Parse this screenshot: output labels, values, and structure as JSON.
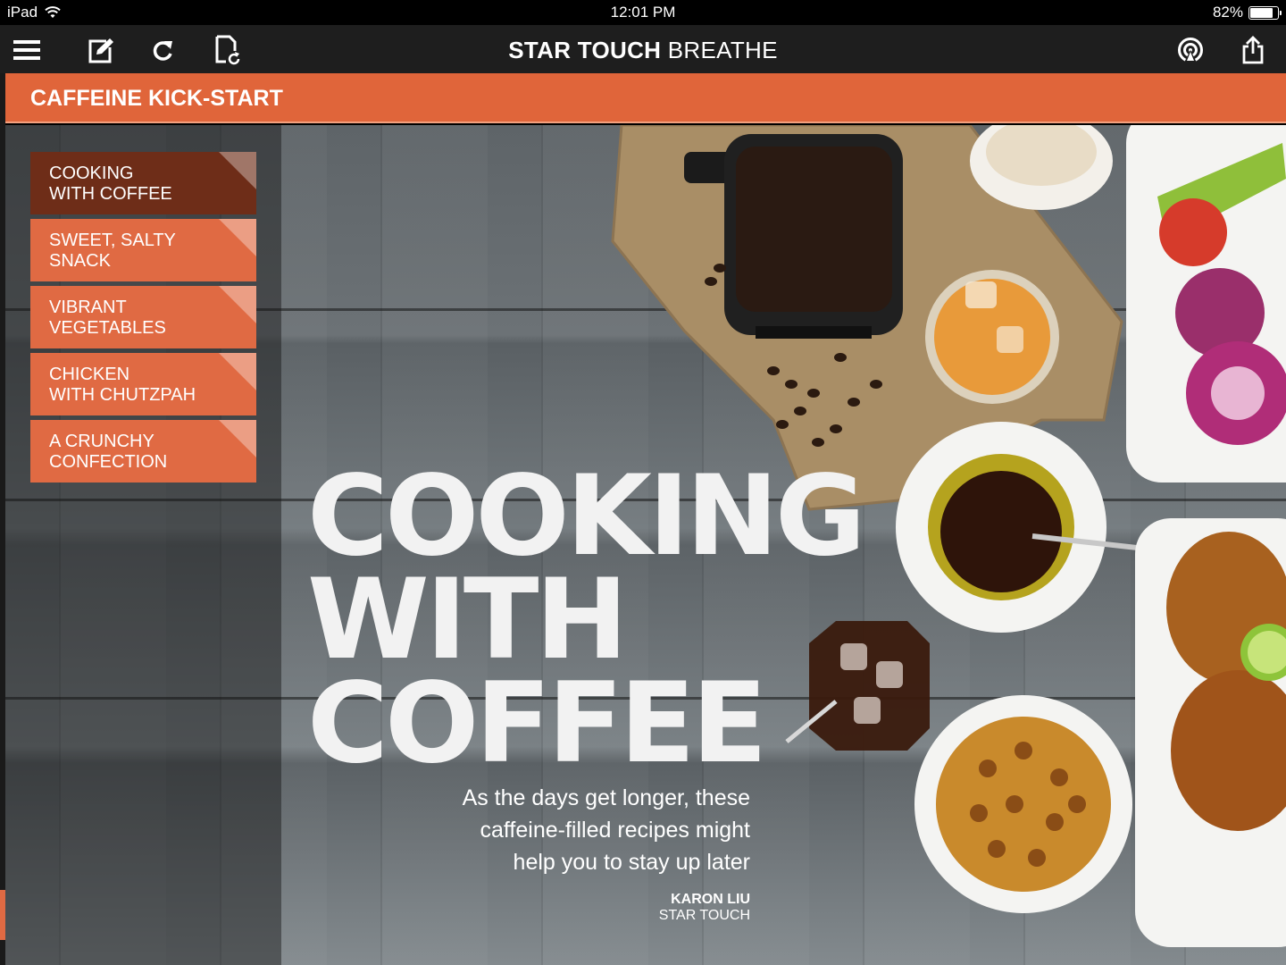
{
  "status_bar": {
    "device": "iPad",
    "time": "12:01 PM",
    "battery": "82%",
    "battery_level": 0.82
  },
  "toolbar": {
    "title_brand": "STAR TOUCH",
    "title_section": " BREATHE"
  },
  "section": {
    "title": "CAFFEINE KICK-START"
  },
  "nav": {
    "items": [
      {
        "line1": "COOKING",
        "line2": "WITH COFFEE"
      },
      {
        "line1": "SWEET, SALTY",
        "line2": "SNACK"
      },
      {
        "line1": "VIBRANT",
        "line2": "VEGETABLES"
      },
      {
        "line1": "CHICKEN",
        "line2": "WITH CHUTZPAH"
      },
      {
        "line1": "A CRUNCHY",
        "line2": "CONFECTION"
      }
    ]
  },
  "article": {
    "headline": [
      "COOKING",
      "WITH",
      "COFFEE"
    ],
    "subtitle_lines": [
      "As the days get longer, these",
      "caffeine-filled recipes might",
      "help you to stay up later"
    ],
    "author": "KARON LIU",
    "publication": "STAR TOUCH"
  },
  "colors": {
    "accent": "#e0653a",
    "active_nav": "#6e2d18",
    "toolbar": "#1e1e1e"
  }
}
